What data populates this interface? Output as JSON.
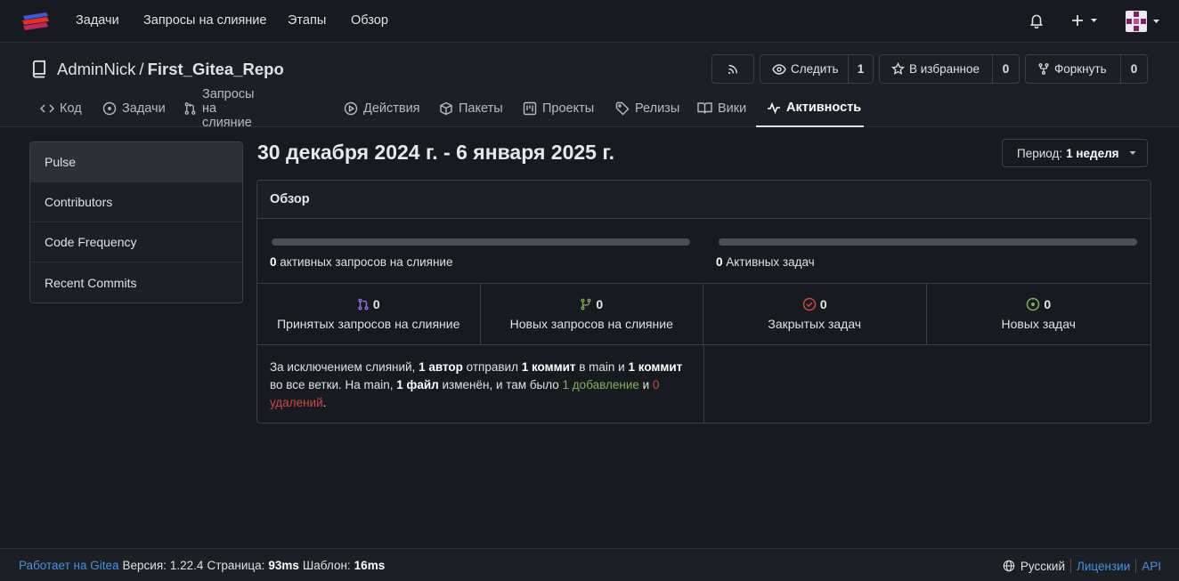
{
  "topnav": {
    "items": [
      "Задачи",
      "Запросы на слияние",
      "Этапы",
      "Обзор"
    ]
  },
  "repo": {
    "owner": "AdminNick",
    "separator": "/",
    "name": "First_Gitea_Repo",
    "watch_label": "Следить",
    "watch_count": "1",
    "star_label": "В избранное",
    "star_count": "0",
    "fork_label": "Форкнуть",
    "fork_count": "0"
  },
  "tabs": [
    {
      "label": "Код",
      "icon": "code-icon"
    },
    {
      "label": "Задачи",
      "icon": "issue-icon"
    },
    {
      "label": "Запросы на слияние",
      "icon": "pull-request-icon"
    },
    {
      "label": "Действия",
      "icon": "play-icon"
    },
    {
      "label": "Пакеты",
      "icon": "package-icon"
    },
    {
      "label": "Проекты",
      "icon": "project-icon"
    },
    {
      "label": "Релизы",
      "icon": "tag-icon"
    },
    {
      "label": "Вики",
      "icon": "book-icon"
    },
    {
      "label": "Активность",
      "icon": "pulse-icon",
      "active": true
    }
  ],
  "sidebar": {
    "items": [
      {
        "label": "Pulse",
        "active": true
      },
      {
        "label": "Contributors"
      },
      {
        "label": "Code Frequency"
      },
      {
        "label": "Recent Commits"
      }
    ]
  },
  "main": {
    "date_range": "30 декабря 2024 г. - 6 января 2025 г.",
    "period_prefix": "Период:",
    "period_value": "1 неделя",
    "overview_title": "Обзор",
    "active_prs_count": "0",
    "active_prs_label": "активных запросов на слияние",
    "active_prs_progress": 0,
    "active_issues_count": "0",
    "active_issues_label": "Активных задач",
    "active_issues_progress": 0,
    "stats": [
      {
        "count": "0",
        "label": "Принятых запросов на слияние",
        "icon": "merged-icon",
        "color": "#a371f7"
      },
      {
        "count": "0",
        "label": "Новых запросов на слияние",
        "icon": "branch-icon",
        "color": "#87ab63"
      },
      {
        "count": "0",
        "label": "Закрытых задач",
        "icon": "closed-issue-icon",
        "color": "#cc4848"
      },
      {
        "count": "0",
        "label": "Новых задач",
        "icon": "open-issue-icon",
        "color": "#87ab63"
      }
    ],
    "summary": {
      "t1": "За исключением слияний, ",
      "b1": "1 автор",
      "t2": " отправил ",
      "b2": "1 коммит",
      "t3": " в main и ",
      "b3": "1 коммит",
      "t4": " во все ветки. На main, ",
      "b4": "1 файл",
      "t5": " изменён, и там было ",
      "add": "1 добавление",
      "t6": " и ",
      "del": "0 удалений",
      "t7": "."
    }
  },
  "footer": {
    "powered": "Работает на Gitea",
    "version_label": "Версия:",
    "version": "1.22.4",
    "page_label": "Страница:",
    "page_time": "93ms",
    "template_label": "Шаблон:",
    "template_time": "16ms",
    "language": "Русский",
    "licenses": "Лицензии",
    "api": "API"
  }
}
